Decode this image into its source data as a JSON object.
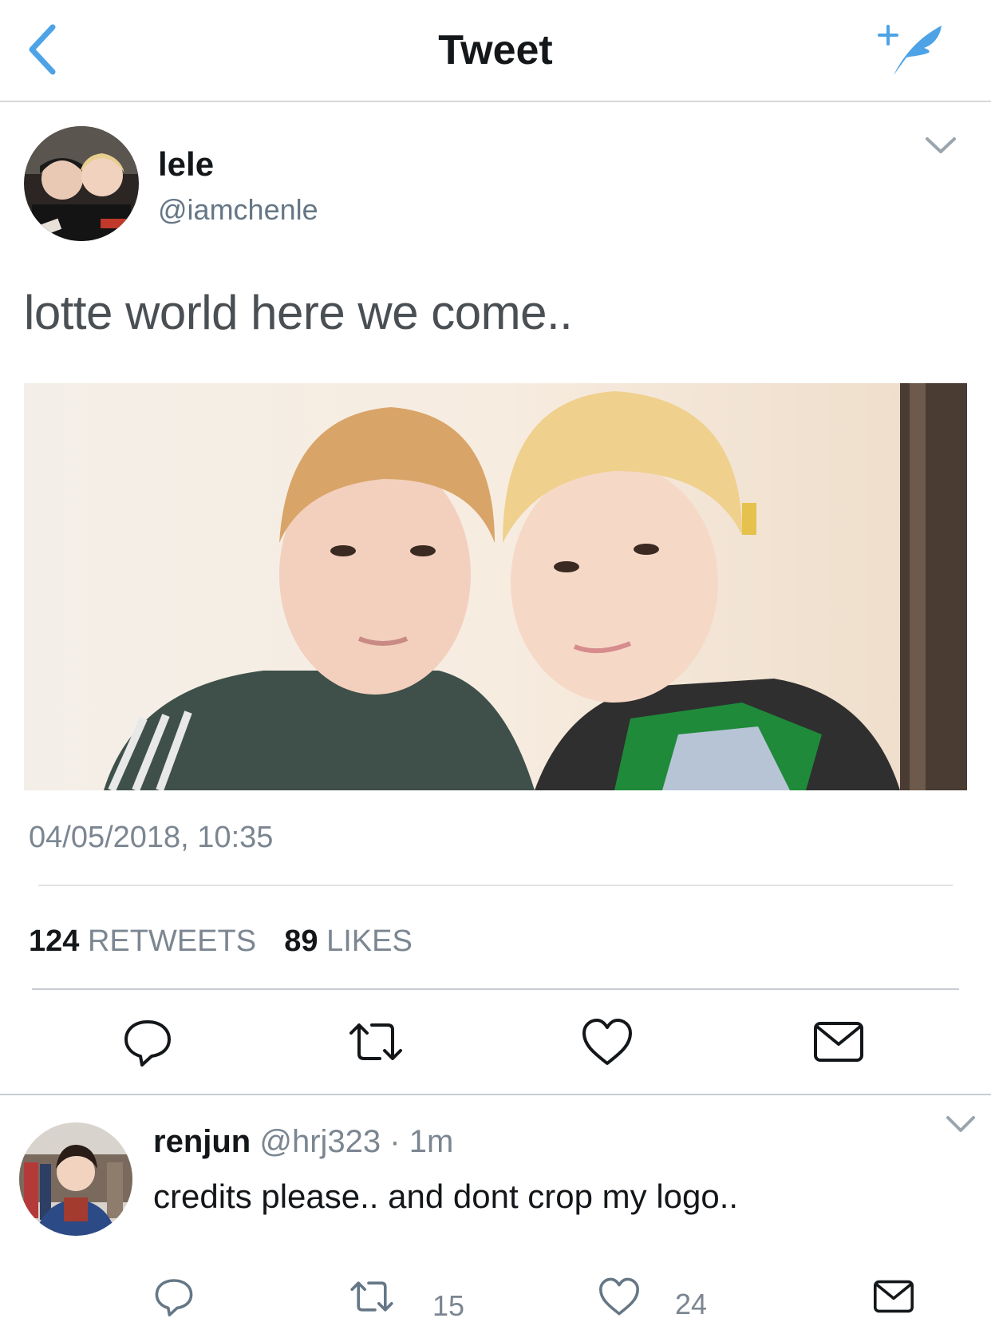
{
  "header": {
    "title": "Tweet",
    "back_icon": "chevron-left-icon",
    "compose_icon": "compose-tweet-icon",
    "accent_color": "#4da3e6"
  },
  "tweet": {
    "author_name": "lele",
    "author_handle": "@iamchenle",
    "text": "lotte world here we come..",
    "timestamp": "04/05/2018, 10:35",
    "retweet_count": "124",
    "retweet_label": "RETWEETS",
    "like_count": "89",
    "like_label": "LIKES",
    "actions": [
      "reply-icon",
      "retweet-icon",
      "like-icon",
      "share-icon"
    ]
  },
  "reply": {
    "author_name": "renjun",
    "author_handle": "@hrj323",
    "separator": "·",
    "time": "1m",
    "text": "credits please.. and dont crop my logo..",
    "retweet_count": "15",
    "like_count": "24"
  }
}
